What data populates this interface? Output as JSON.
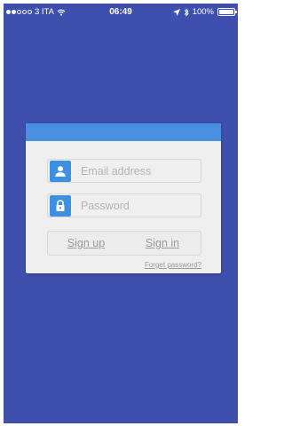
{
  "status_bar": {
    "carrier": "3 ITA",
    "time": "06:49",
    "battery": "100%",
    "signal_bars_filled": 2,
    "signal_bars_total": 5
  },
  "login": {
    "email_placeholder": "Email address",
    "password_placeholder": "Password",
    "sign_up_label": "Sign up",
    "sign_in_label": "Sign in",
    "forget_password_label": "Forget password?"
  },
  "colors": {
    "background": "#3f4fad",
    "header": "#4a90e2",
    "icon": "#3d8fe0",
    "card": "#efefef"
  },
  "icons": {
    "email": "user-icon",
    "password": "lock-icon"
  }
}
